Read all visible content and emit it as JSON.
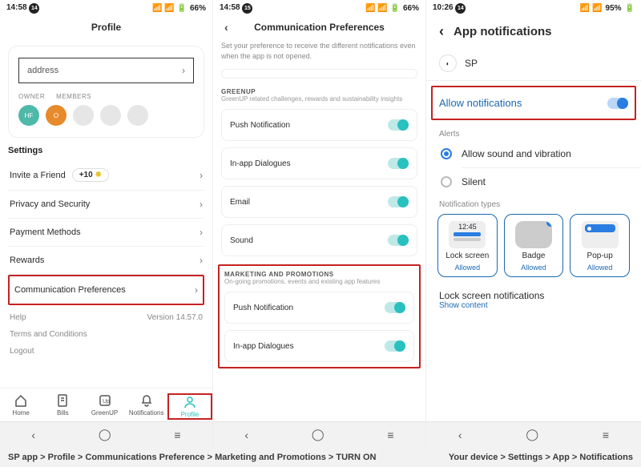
{
  "phone1": {
    "status_time": "14:58",
    "status_badge": "14",
    "status_right": "66%",
    "title": "Profile",
    "address_label": "address",
    "owner_label": "OWNER",
    "members_label": "MEMBERS",
    "owner_initials": "HF",
    "member_initials": "O",
    "settings_label": "Settings",
    "rows": {
      "invite": "Invite a Friend",
      "invite_badge": "+10",
      "privacy": "Privacy and Security",
      "payment": "Payment Methods",
      "rewards": "Rewards",
      "comm": "Communication Preferences",
      "help": "Help",
      "version": "Version 14.57.0",
      "terms": "Terms and Conditions",
      "logout": "Logout"
    },
    "tabs": {
      "home": "Home",
      "bills": "Bills",
      "greenup": "GreenUP",
      "notif": "Notifications",
      "profile": "Profile"
    }
  },
  "phone2": {
    "status_time": "14:58",
    "status_badge": "15",
    "status_right": "66%",
    "title": "Communication Preferences",
    "intro": "Set your preference to receive the different notifications even when the app is not opened.",
    "greenup_head": "GREENUP",
    "greenup_sub": "GreenUP related challenges, rewards and sustainability insights",
    "greenup_items": {
      "push": "Push Notification",
      "inapp": "In-app Dialogues",
      "email": "Email",
      "sound": "Sound"
    },
    "mkt_head": "MARKETING AND PROMOTIONS",
    "mkt_sub": "On-going promotions, events and existing app features",
    "mkt_items": {
      "push": "Push Notification",
      "inapp": "In-app Dialogues"
    }
  },
  "phone3": {
    "status_time": "10:26",
    "status_badge": "14",
    "status_right": "95%",
    "title": "App notifications",
    "app_name": "SP",
    "allow": "Allow notifications",
    "alerts_label": "Alerts",
    "sound_vibration": "Allow sound and vibration",
    "silent": "Silent",
    "types_label": "Notification types",
    "types": {
      "lock_time": "12:45",
      "lock": "Lock screen",
      "badge": "Badge",
      "popup": "Pop-up",
      "allowed": "Allowed"
    },
    "lock_notif": "Lock screen notifications",
    "show_content": "Show content"
  },
  "caption_left": "SP app > Profile > Communications Preference > Marketing and Promotions > TURN ON",
  "caption_right": "Your device > Settings > App > Notifications"
}
